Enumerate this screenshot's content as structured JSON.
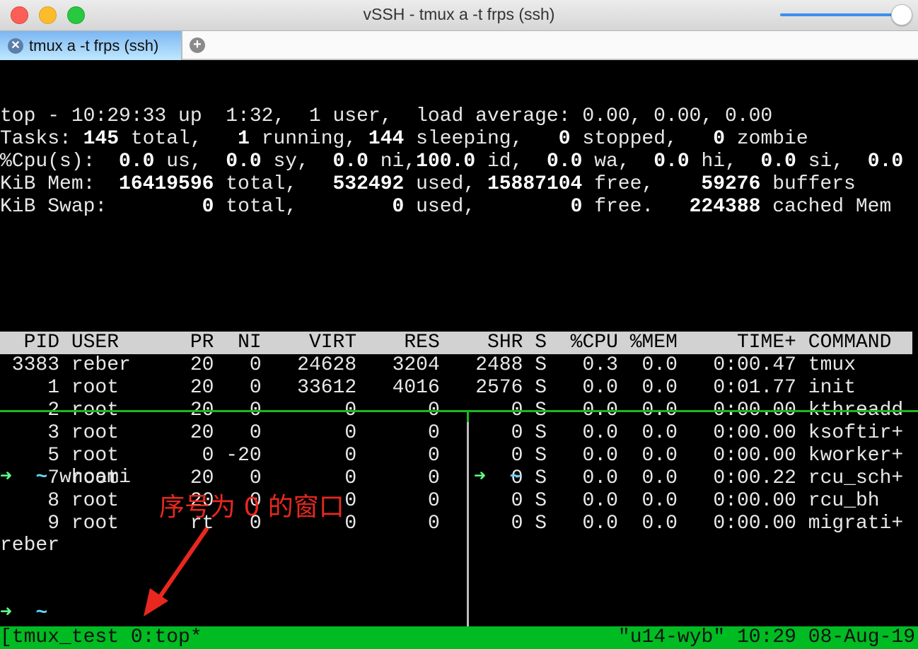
{
  "window": {
    "title": "vSSH - tmux a -t frps (ssh)"
  },
  "tabs": [
    {
      "label": "tmux a -t frps (ssh)"
    }
  ],
  "top_summary": [
    [
      {
        "t": "top - 10:29:33 up  1:32,  1 user,  load average: 0.00, 0.00, 0.00",
        "b": false
      }
    ],
    [
      {
        "t": "Tasks: ",
        "b": false
      },
      {
        "t": "145",
        "b": true
      },
      {
        "t": " total,   ",
        "b": false
      },
      {
        "t": "1",
        "b": true
      },
      {
        "t": " running, ",
        "b": false
      },
      {
        "t": "144",
        "b": true
      },
      {
        "t": " sleeping,   ",
        "b": false
      },
      {
        "t": "0",
        "b": true
      },
      {
        "t": " stopped,   ",
        "b": false
      },
      {
        "t": "0",
        "b": true
      },
      {
        "t": " zombie",
        "b": false
      }
    ],
    [
      {
        "t": "%Cpu(s):  ",
        "b": false
      },
      {
        "t": "0.0",
        "b": true
      },
      {
        "t": " us,  ",
        "b": false
      },
      {
        "t": "0.0",
        "b": true
      },
      {
        "t": " sy,  ",
        "b": false
      },
      {
        "t": "0.0",
        "b": true
      },
      {
        "t": " ni,",
        "b": false
      },
      {
        "t": "100.0",
        "b": true
      },
      {
        "t": " id,  ",
        "b": false
      },
      {
        "t": "0.0",
        "b": true
      },
      {
        "t": " wa,  ",
        "b": false
      },
      {
        "t": "0.0",
        "b": true
      },
      {
        "t": " hi,  ",
        "b": false
      },
      {
        "t": "0.0",
        "b": true
      },
      {
        "t": " si,  ",
        "b": false
      },
      {
        "t": "0.0",
        "b": true
      }
    ],
    [
      {
        "t": "KiB Mem:  ",
        "b": false
      },
      {
        "t": "16419596",
        "b": true
      },
      {
        "t": " total,   ",
        "b": false
      },
      {
        "t": "532492",
        "b": true
      },
      {
        "t": " used, ",
        "b": false
      },
      {
        "t": "15887104",
        "b": true
      },
      {
        "t": " free,    ",
        "b": false
      },
      {
        "t": "59276",
        "b": true
      },
      {
        "t": " buffers",
        "b": false
      }
    ],
    [
      {
        "t": "KiB Swap:        ",
        "b": false
      },
      {
        "t": "0",
        "b": true
      },
      {
        "t": " total,        ",
        "b": false
      },
      {
        "t": "0",
        "b": true
      },
      {
        "t": " used,        ",
        "b": false
      },
      {
        "t": "0",
        "b": true
      },
      {
        "t": " free.   ",
        "b": false
      },
      {
        "t": "224388",
        "b": true
      },
      {
        "t": " cached Mem",
        "b": false
      }
    ]
  ],
  "process_table": {
    "columns": [
      "PID",
      "USER",
      "PR",
      "NI",
      "VIRT",
      "RES",
      "SHR",
      "S",
      "%CPU",
      "%MEM",
      "TIME+",
      "COMMAND"
    ],
    "rows": [
      [
        "3383",
        "reber",
        "20",
        "0",
        "24628",
        "3204",
        "2488",
        "S",
        "0.3",
        "0.0",
        "0:00.47",
        "tmux"
      ],
      [
        "1",
        "root",
        "20",
        "0",
        "33612",
        "4016",
        "2576",
        "S",
        "0.0",
        "0.0",
        "0:01.77",
        "init"
      ],
      [
        "2",
        "root",
        "20",
        "0",
        "0",
        "0",
        "0",
        "S",
        "0.0",
        "0.0",
        "0:00.00",
        "kthreadd"
      ],
      [
        "3",
        "root",
        "20",
        "0",
        "0",
        "0",
        "0",
        "S",
        "0.0",
        "0.0",
        "0:00.00",
        "ksoftir+"
      ],
      [
        "5",
        "root",
        "0",
        "-20",
        "0",
        "0",
        "0",
        "S",
        "0.0",
        "0.0",
        "0:00.00",
        "kworker+"
      ],
      [
        "7",
        "root",
        "20",
        "0",
        "0",
        "0",
        "0",
        "S",
        "0.0",
        "0.0",
        "0:00.22",
        "rcu_sch+"
      ],
      [
        "8",
        "root",
        "20",
        "0",
        "0",
        "0",
        "0",
        "S",
        "0.0",
        "0.0",
        "0:00.00",
        "rcu_bh"
      ],
      [
        "9",
        "root",
        "rt",
        "0",
        "0",
        "0",
        "0",
        "S",
        "0.0",
        "0.0",
        "0:00.00",
        "migrati+"
      ]
    ]
  },
  "left_pane": {
    "prompt_arrow": "➜",
    "prompt_dir": "~",
    "command": "whoami",
    "output": "reber"
  },
  "right_pane": {
    "prompt_arrow": "➜",
    "prompt_dir": "~"
  },
  "status_bar": {
    "left": "[tmux_test 0:top*",
    "right": "\"u14-wyb\" 10:29 08-Aug-19"
  },
  "annotation": {
    "text": "序号为 0 的窗口",
    "color": "#e8281e"
  }
}
